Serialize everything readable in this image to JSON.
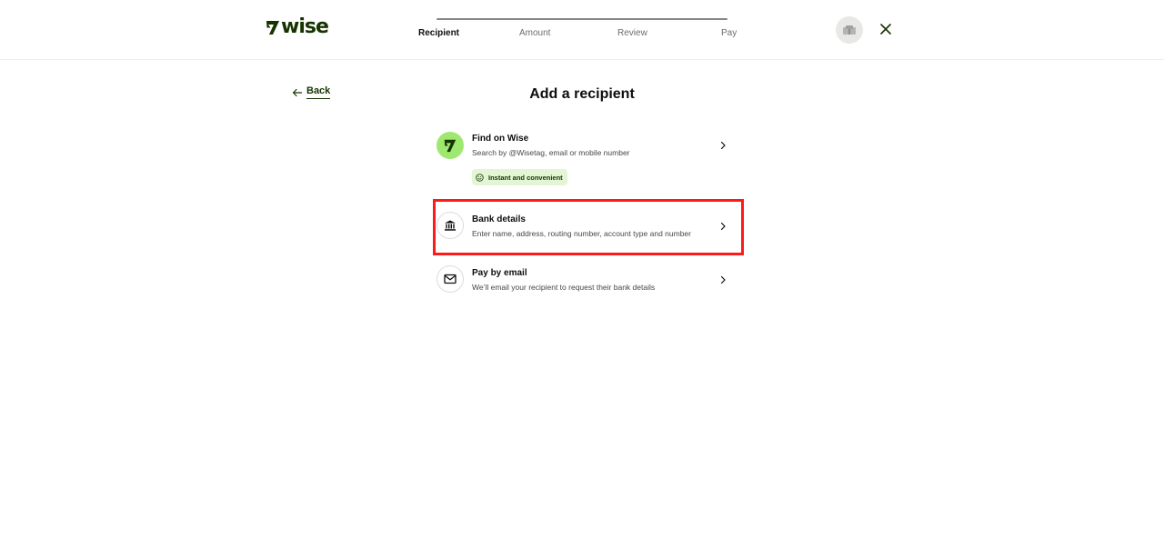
{
  "header": {
    "brand": "wise",
    "steps": [
      {
        "label": "Recipient",
        "active": true
      },
      {
        "label": "Amount",
        "active": false
      },
      {
        "label": "Review",
        "active": false
      },
      {
        "label": "Pay",
        "active": false
      }
    ],
    "icons": {
      "avatar": "avatar-icon",
      "close": "close-icon"
    }
  },
  "nav": {
    "back_label": "Back"
  },
  "main": {
    "title": "Add a recipient",
    "options": [
      {
        "title": "Find on Wise",
        "description": "Search by @Wisetag, email or mobile number",
        "tag": "Instant and convenient",
        "icon": "wise-icon"
      },
      {
        "title": "Bank details",
        "description": "Enter name, address, routing number, account type and number",
        "icon": "bank-icon",
        "highlighted": true
      },
      {
        "title": "Pay by email",
        "description": "We’ll email your recipient to request their bank details",
        "icon": "envelope-icon"
      }
    ]
  },
  "colors": {
    "brand_green": "#163300",
    "bright_green": "#9fe870",
    "highlight": "#ff1a1a",
    "tag_bg": "#e2f6d5"
  }
}
